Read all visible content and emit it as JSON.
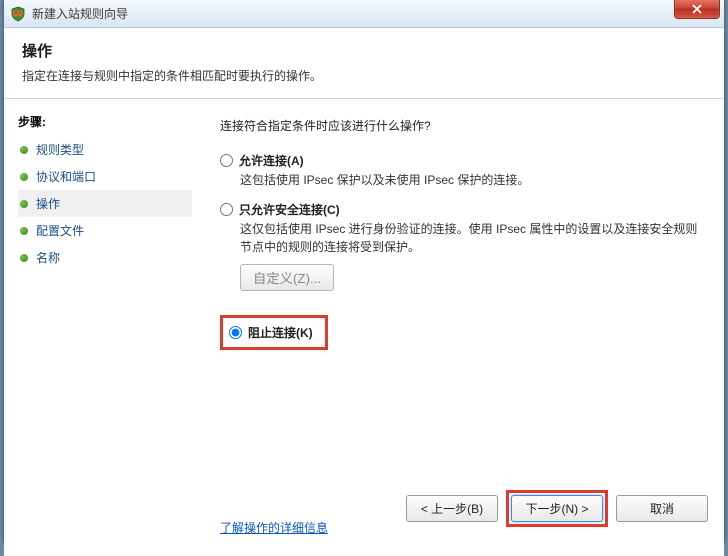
{
  "window": {
    "title": "新建入站规则向导"
  },
  "header": {
    "title": "操作",
    "subtitle": "指定在连接与规则中指定的条件相匹配时要执行的操作。"
  },
  "sidebar": {
    "steps_label": "步骤:",
    "items": [
      {
        "label": "规则类型"
      },
      {
        "label": "协议和端口"
      },
      {
        "label": "操作"
      },
      {
        "label": "配置文件"
      },
      {
        "label": "名称"
      }
    ]
  },
  "content": {
    "prompt": "连接符合指定条件时应该进行什么操作?",
    "options": {
      "allow": {
        "label": "允许连接(A)",
        "desc": "这包括使用 IPsec 保护以及未使用 IPsec 保护的连接。"
      },
      "secure": {
        "label": "只允许安全连接(C)",
        "desc": "这仅包括使用 IPsec 进行身份验证的连接。使用 IPsec 属性中的设置以及连接安全规则节点中的规则的连接将受到保护。",
        "custom_button": "自定义(Z)..."
      },
      "block": {
        "label": "阻止连接(K)"
      }
    },
    "link": "了解操作的详细信息"
  },
  "footer": {
    "back": "< 上一步(B)",
    "next": "下一步(N) >",
    "cancel": "取消"
  }
}
